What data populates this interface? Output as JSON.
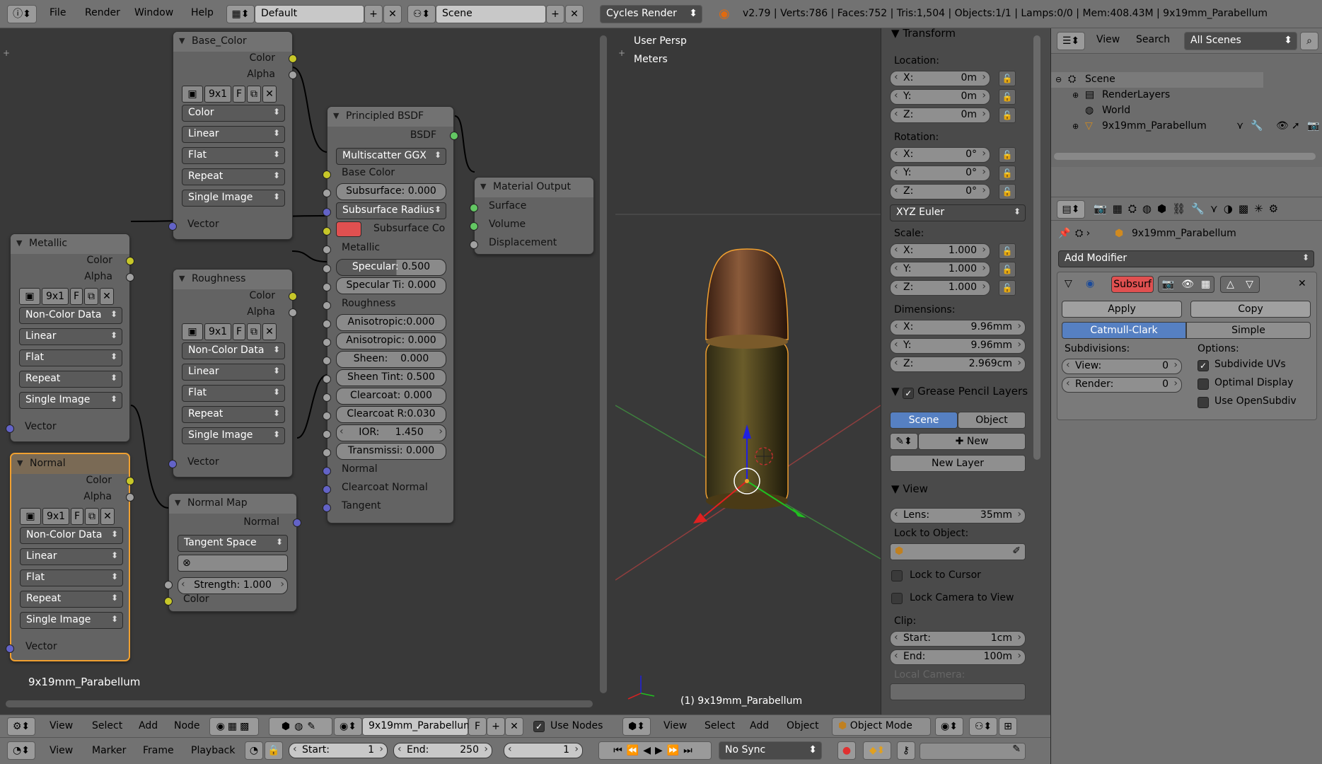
{
  "topbar": {
    "menus": [
      "File",
      "Render",
      "Window",
      "Help"
    ],
    "layout": "Default",
    "scene": "Scene",
    "engine": "Cycles Render",
    "stats": "v2.79 | Verts:786 | Faces:752 | Tris:1,504 | Objects:1/1 | Lamps:0/0 | Mem:408.43M | 9x19mm_Parabellum"
  },
  "nodes": {
    "base_color": {
      "title": "Base_Color",
      "out_color": "Color",
      "out_alpha": "Alpha",
      "img": "9x1",
      "img_f": "F",
      "color_space": "Color",
      "interp": "Linear",
      "proj": "Flat",
      "ext": "Repeat",
      "source": "Single Image",
      "in_vector": "Vector"
    },
    "metallic": {
      "title": "Metallic",
      "out_color": "Color",
      "out_alpha": "Alpha",
      "img": "9x1",
      "img_f": "F",
      "color_space": "Non-Color Data",
      "interp": "Linear",
      "proj": "Flat",
      "ext": "Repeat",
      "source": "Single Image",
      "in_vector": "Vector"
    },
    "roughness": {
      "title": "Roughness",
      "out_color": "Color",
      "out_alpha": "Alpha",
      "img": "9x1",
      "img_f": "F",
      "color_space": "Non-Color Data",
      "interp": "Linear",
      "proj": "Flat",
      "ext": "Repeat",
      "source": "Single Image",
      "in_vector": "Vector"
    },
    "normal": {
      "title": "Normal",
      "out_color": "Color",
      "out_alpha": "Alpha",
      "img": "9x1",
      "img_f": "F",
      "color_space": "Non-Color Data",
      "interp": "Linear",
      "proj": "Flat",
      "ext": "Repeat",
      "source": "Single Image",
      "in_vector": "Vector"
    },
    "normal_map": {
      "title": "Normal Map",
      "out_normal": "Normal",
      "space": "Tangent Space",
      "strength_label": "Strength:",
      "strength": "1.000",
      "in_color": "Color"
    },
    "principled": {
      "title": "Principled BSDF",
      "out": "BSDF",
      "dist": "Multiscatter GGX",
      "base_color": "Base Color",
      "subsurface": "Subsurface:",
      "subsurface_v": "0.000",
      "ss_radius": "Subsurface Radius",
      "ss_color": "Subsurface Co",
      "metallic": "Metallic",
      "specular": "Specular:",
      "specular_v": "0.500",
      "spec_tint": "Specular Ti:",
      "spec_tint_v": "0.000",
      "roughness": "Roughness",
      "aniso": "Anisotropic:",
      "aniso_v": "0.000",
      "aniso_rot": "Anisotropic:",
      "aniso_rot_v": "0.000",
      "sheen": "Sheen:",
      "sheen_v": "0.000",
      "sheen_tint": "Sheen Tint:",
      "sheen_tint_v": "0.500",
      "clearcoat": "Clearcoat:",
      "clearcoat_v": "0.000",
      "cc_rough": "Clearcoat R:",
      "cc_rough_v": "0.030",
      "ior": "IOR:",
      "ior_v": "1.450",
      "trans": "Transmissi:",
      "trans_v": "0.000",
      "normal": "Normal",
      "cc_normal": "Clearcoat Normal",
      "tangent": "Tangent"
    },
    "output": {
      "title": "Material Output",
      "surface": "Surface",
      "volume": "Volume",
      "displacement": "Displacement"
    }
  },
  "node_editor": {
    "material_label": "9x19mm_Parabellum",
    "header": {
      "view": "View",
      "select": "Select",
      "add": "Add",
      "node": "Node",
      "material": "9x19mm_Parabellum",
      "f": "F",
      "use_nodes": "Use Nodes"
    }
  },
  "viewport": {
    "persp": "User Persp",
    "units": "Meters",
    "object_label": "(1) 9x19mm_Parabellum",
    "header": {
      "view": "View",
      "select": "Select",
      "add": "Add",
      "object": "Object",
      "mode": "Object Mode"
    }
  },
  "npanel": {
    "transform": "Transform",
    "location": "Location:",
    "loc": [
      {
        "k": "X:",
        "v": "0m"
      },
      {
        "k": "Y:",
        "v": "0m"
      },
      {
        "k": "Z:",
        "v": "0m"
      }
    ],
    "rotation": "Rotation:",
    "rot": [
      {
        "k": "X:",
        "v": "0°"
      },
      {
        "k": "Y:",
        "v": "0°"
      },
      {
        "k": "Z:",
        "v": "0°"
      }
    ],
    "rot_mode": "XYZ Euler",
    "scale": "Scale:",
    "scl": [
      {
        "k": "X:",
        "v": "1.000"
      },
      {
        "k": "Y:",
        "v": "1.000"
      },
      {
        "k": "Z:",
        "v": "1.000"
      }
    ],
    "dimensions": "Dimensions:",
    "dim": [
      {
        "k": "X:",
        "v": "9.96mm"
      },
      {
        "k": "Y:",
        "v": "9.96mm"
      },
      {
        "k": "Z:",
        "v": "2.969cm"
      }
    ],
    "gp": "Grease Pencil Layers",
    "gp_scene": "Scene",
    "gp_object": "Object",
    "gp_new": "New",
    "gp_new_layer": "New Layer",
    "view": "View",
    "lens_k": "Lens:",
    "lens_v": "35mm",
    "lock_obj": "Lock to Object:",
    "lock_cursor": "Lock to Cursor",
    "lock_cam": "Lock Camera to View",
    "clip": "Clip:",
    "clip_start_k": "Start:",
    "clip_start_v": "1cm",
    "clip_end_k": "End:",
    "clip_end_v": "100m",
    "local_cam": "Local Camera:"
  },
  "outliner": {
    "view": "View",
    "search": "Search",
    "filter": "All Scenes",
    "items": [
      "Scene",
      "RenderLayers",
      "World",
      "9x19mm_Parabellum"
    ]
  },
  "properties": {
    "object": "9x19mm_Parabellum",
    "add_modifier": "Add Modifier",
    "mod_name": "Subsurf",
    "apply": "Apply",
    "copy": "Copy",
    "catmull": "Catmull-Clark",
    "simple": "Simple",
    "subdivisions": "Subdivisions:",
    "options": "Options:",
    "view_k": "View:",
    "view_v": "0",
    "render_k": "Render:",
    "render_v": "0",
    "subdiv_uvs": "Subdivide UVs",
    "optimal": "Optimal Display",
    "opensubdiv": "Use OpenSubdiv"
  },
  "timeline": {
    "view": "View",
    "marker": "Marker",
    "frame": "Frame",
    "playback": "Playback",
    "start_k": "Start:",
    "start_v": "1",
    "end_k": "End:",
    "end_v": "250",
    "current": "1",
    "sync": "No Sync"
  },
  "colors": {
    "accent": "#5680c2",
    "selected_node": "#f0a030",
    "socket_yellow": "#c7c729",
    "socket_green": "#63c763",
    "socket_blue": "#6363c7",
    "modifier_red": "#e05050"
  }
}
